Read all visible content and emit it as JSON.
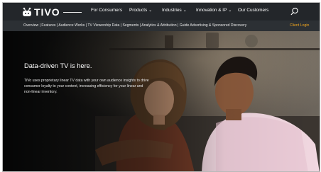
{
  "brand": {
    "logo_text": "TIVO"
  },
  "nav": {
    "items": [
      {
        "label": "For Consumers",
        "has_menu": false
      },
      {
        "label": "Products",
        "has_menu": true
      },
      {
        "label": "Industries",
        "has_menu": true
      },
      {
        "label": "Innovation & IP",
        "has_menu": true
      },
      {
        "label": "Our Customers",
        "has_menu": false
      }
    ],
    "search_icon": "search-icon"
  },
  "subnav": {
    "links_text": "Overview | Features | Audience Works | TV Viewership Data | Segments | Analytics & Attribution | Guide Advertising & Sponsored Discovery",
    "client_login": "Client Login"
  },
  "hero": {
    "title": "Data-driven TV is here.",
    "body": "TiVo uses proprietary linear TV data with your own audience insights to drive consumer loyalty to your content, increasing efficiency for your linear and non-linear inventory."
  },
  "colors": {
    "nav_bg": "#23262a",
    "subnav_bg": "#2c3034",
    "accent": "#f0a51f"
  }
}
